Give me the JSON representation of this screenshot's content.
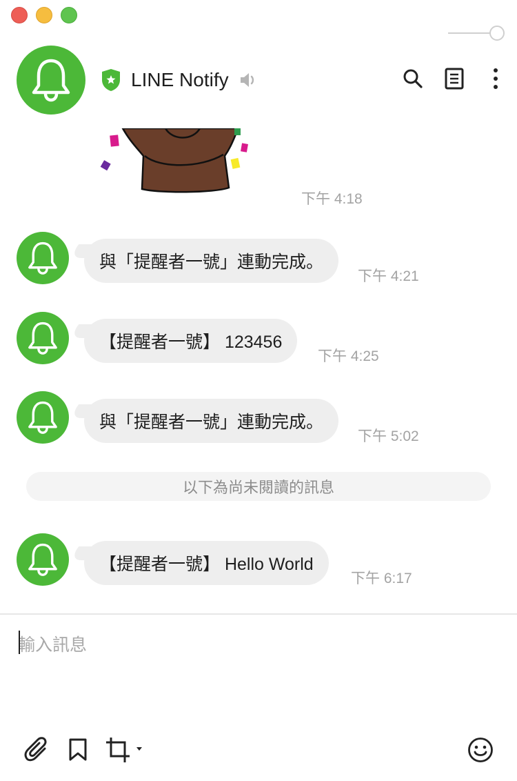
{
  "window": {
    "colors": {
      "close": "#ee5e56",
      "minimize": "#f6bd3f",
      "zoom": "#5fc44f"
    }
  },
  "header": {
    "title": "LINE Notify",
    "icons": [
      "bell-icon",
      "shield-star-icon",
      "speaker-muted-icon",
      "search-icon",
      "notes-icon",
      "more-vertical-icon"
    ]
  },
  "sticker": {
    "time": "下午 4:18"
  },
  "messages": [
    {
      "text": "與「提醒者一號」連動完成。",
      "time": "下午 4:21"
    },
    {
      "text": "【提醒者一號】 123456",
      "time": "下午 4:25"
    },
    {
      "text": "與「提醒者一號」連動完成。",
      "time": "下午 5:02"
    },
    {
      "text": "【提醒者一號】 Hello World",
      "time": "下午 6:17"
    }
  ],
  "unread_divider": "以下為尚未閱讀的訊息",
  "composer": {
    "placeholder": "輸入訊息",
    "value": "",
    "tools": [
      "attachment-icon",
      "bookmark-icon",
      "crop-icon",
      "emoji-icon"
    ]
  },
  "colors": {
    "brand_green": "#4cb838",
    "bubble": "#eeeeee",
    "timestamp": "#a3a3a3"
  }
}
